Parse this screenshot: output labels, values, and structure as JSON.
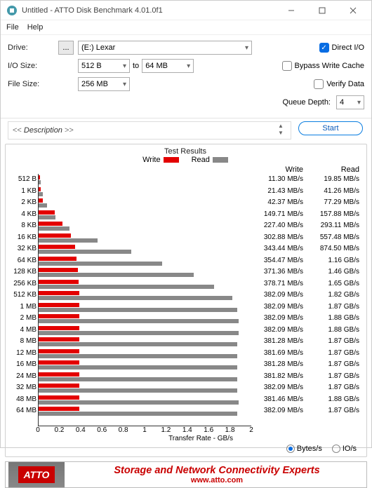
{
  "window": {
    "title": "Untitled - ATTO Disk Benchmark 4.01.0f1"
  },
  "menu": {
    "file": "File",
    "help": "Help"
  },
  "form": {
    "drive_label": "Drive:",
    "drive_value": "(E:) Lexar",
    "dots": "...",
    "io_label": "I/O Size:",
    "io_from": "512 B",
    "io_to_word": "to",
    "io_to": "64 MB",
    "fs_label": "File Size:",
    "fs_value": "256 MB",
    "direct_io": "Direct I/O",
    "bypass": "Bypass Write Cache",
    "verify": "Verify Data",
    "qd_label": "Queue Depth:",
    "qd_value": "4"
  },
  "desc": {
    "label": "Description",
    "start": "Start"
  },
  "results": {
    "title": "Test Results",
    "legend_write": "Write",
    "legend_read": "Read",
    "xlabel": "Transfer Rate - GB/s",
    "bytes_s": "Bytes/s",
    "io_s": "IO/s"
  },
  "banner": {
    "logo": "ATTO",
    "tagline": "Storage and Network Connectivity Experts",
    "site": "www.atto.com"
  },
  "chart_data": {
    "type": "bar",
    "title": "Test Results",
    "xlabel": "Transfer Rate - GB/s",
    "xlim": [
      0,
      2
    ],
    "xticks": [
      0,
      0.2,
      0.4,
      0.6,
      0.8,
      1.0,
      1.2,
      1.4,
      1.6,
      1.8,
      2.0
    ],
    "series_names": [
      "Write",
      "Read"
    ],
    "categories": [
      "512 B",
      "1 KB",
      "2 KB",
      "4 KB",
      "8 KB",
      "16 KB",
      "32 KB",
      "64 KB",
      "128 KB",
      "256 KB",
      "512 KB",
      "1 MB",
      "2 MB",
      "4 MB",
      "8 MB",
      "12 MB",
      "16 MB",
      "24 MB",
      "32 MB",
      "48 MB",
      "64 MB"
    ],
    "write_display": [
      "11.30 MB/s",
      "21.43 MB/s",
      "42.37 MB/s",
      "149.71 MB/s",
      "227.40 MB/s",
      "302.88 MB/s",
      "343.44 MB/s",
      "354.47 MB/s",
      "371.36 MB/s",
      "378.71 MB/s",
      "382.09 MB/s",
      "382.09 MB/s",
      "382.09 MB/s",
      "382.09 MB/s",
      "381.28 MB/s",
      "381.69 MB/s",
      "381.28 MB/s",
      "381.82 MB/s",
      "382.09 MB/s",
      "381.46 MB/s",
      "382.09 MB/s"
    ],
    "read_display": [
      "19.85 MB/s",
      "41.26 MB/s",
      "77.29 MB/s",
      "157.88 MB/s",
      "293.11 MB/s",
      "557.48 MB/s",
      "874.50 MB/s",
      "1.16 GB/s",
      "1.46 GB/s",
      "1.65 GB/s",
      "1.82 GB/s",
      "1.87 GB/s",
      "1.88 GB/s",
      "1.88 GB/s",
      "1.87 GB/s",
      "1.87 GB/s",
      "1.87 GB/s",
      "1.87 GB/s",
      "1.87 GB/s",
      "1.88 GB/s",
      "1.87 GB/s"
    ],
    "write_gbps": [
      0.0113,
      0.02143,
      0.04237,
      0.14971,
      0.2274,
      0.30288,
      0.34344,
      0.35447,
      0.37136,
      0.37871,
      0.38209,
      0.38209,
      0.38209,
      0.38209,
      0.38128,
      0.38169,
      0.38128,
      0.38182,
      0.38209,
      0.38146,
      0.38209
    ],
    "read_gbps": [
      0.01985,
      0.04126,
      0.07729,
      0.15788,
      0.29311,
      0.55748,
      0.8745,
      1.16,
      1.46,
      1.65,
      1.82,
      1.87,
      1.88,
      1.88,
      1.87,
      1.87,
      1.87,
      1.87,
      1.87,
      1.88,
      1.87
    ]
  }
}
